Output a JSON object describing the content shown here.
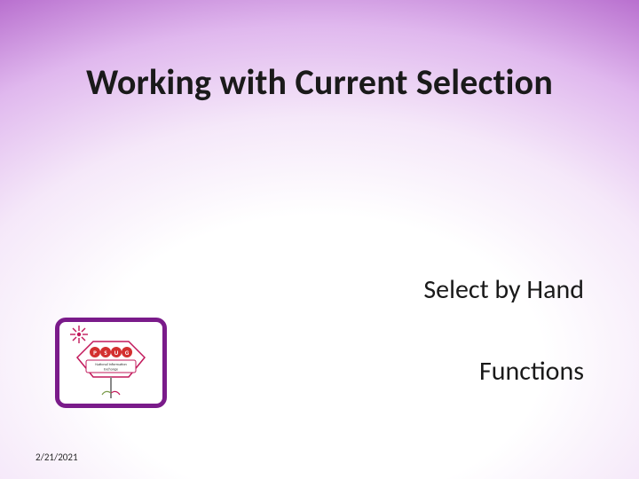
{
  "slide": {
    "title": "Working with Current Selection",
    "subtitle1": "Select by Hand",
    "subtitle2": "Functions",
    "footer_date": "2/21/2021",
    "logo": {
      "label_top": "PSUG",
      "banner": "National Information Exchange"
    }
  },
  "colors": {
    "accent": "#7a1b8a",
    "text": "#1a1a1a"
  }
}
